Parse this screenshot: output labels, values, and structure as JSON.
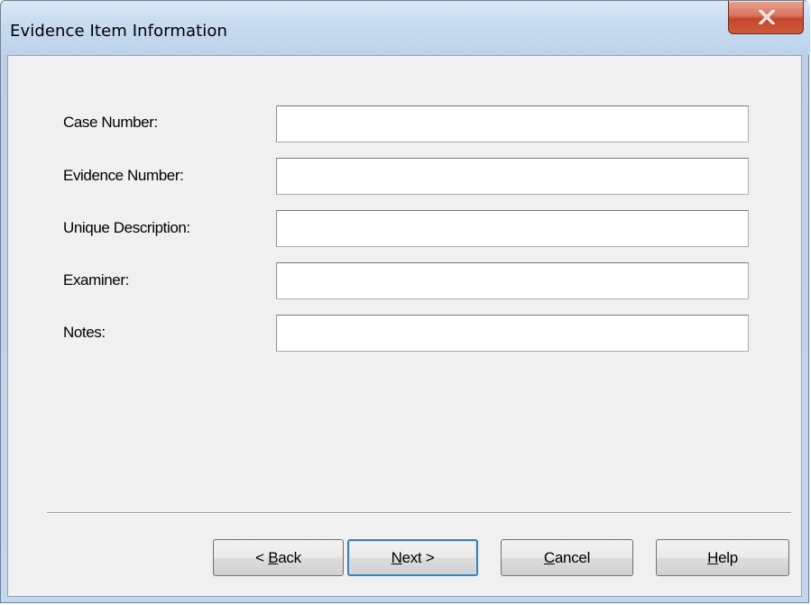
{
  "window": {
    "title": "Evidence Item Information",
    "close_icon": "close-x-icon"
  },
  "form": {
    "fields": [
      {
        "label": "Case Number:",
        "value": "",
        "placeholder": ""
      },
      {
        "label": "Evidence Number:",
        "value": "",
        "placeholder": ""
      },
      {
        "label": "Unique Description:",
        "value": "",
        "placeholder": ""
      },
      {
        "label": "Examiner:",
        "value": "",
        "placeholder": ""
      },
      {
        "label": "Notes:",
        "value": "",
        "placeholder": ""
      }
    ]
  },
  "buttons": {
    "back": {
      "prefix": "< ",
      "accel": "B",
      "rest": "ack"
    },
    "next": {
      "prefix": "",
      "accel": "N",
      "rest": "ext >"
    },
    "cancel": {
      "prefix": "",
      "accel": "C",
      "rest": "ancel"
    },
    "help": {
      "prefix": "",
      "accel": "H",
      "rest": "elp"
    }
  },
  "colors": {
    "close_button": "#c4462b",
    "frame": "#bcd1e8",
    "client": "#f0f0f0",
    "default_button_border": "#3c7fb1"
  }
}
